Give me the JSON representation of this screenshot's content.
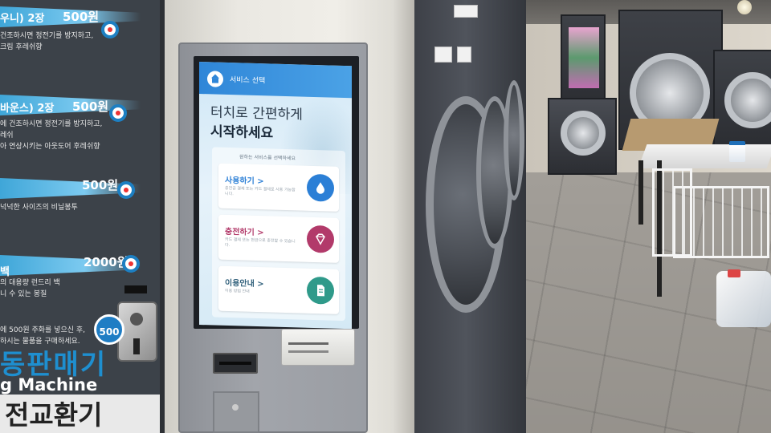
{
  "kiosk_screen": {
    "header_title": "서비스 선택",
    "headline_line1": "터치로 간편하게",
    "headline_line2": "시작하세요",
    "hint": "원하는 서비스를 선택하세요",
    "cards": [
      {
        "title": "사용하기 >",
        "sub": "충전금 결제 또는 카드 결제로 사용 가능합니다.",
        "icon": "water-drop-icon",
        "color": "#2b7fd6"
      },
      {
        "title": "충전하기 >",
        "sub": "카드 결제 또는 현금으로 충전할 수 있습니다.",
        "icon": "diamond-icon",
        "color": "#b23a6a"
      },
      {
        "title": "이용안내 >",
        "sub": "이용 방법 안내",
        "icon": "document-icon",
        "color": "#2f9a8a"
      }
    ]
  },
  "poster": {
    "items": [
      {
        "name": "우니) 2장",
        "price": "500원",
        "desc": "건조하시면 정전기를 방지하고,\n크림 후레쉬향"
      },
      {
        "name": "바운스) 2장",
        "price": "500원",
        "desc": "에 건조하시면 정전기를 방지하고,\n레쉬\n아 연상시키는 아웃도어 후레쉬향"
      },
      {
        "name": "",
        "price": "500원",
        "desc": "넉넉한 사이즈의 비닐봉투"
      },
      {
        "name": "백",
        "price": "2000원",
        "desc": "의 대용량 런드리 백\n니 수 있는 봉질"
      }
    ],
    "coin_note": "에 500원 주화를 넣으신 후,\n하시는 물품을 구매하세요.",
    "coin_badge": "500",
    "vending_title": "동판매기",
    "vending_sub": "g Machine",
    "exchanger": "전교환기"
  },
  "colors": {
    "kiosk_accent": "#2f86d8",
    "poster_blue": "#3fa6d8"
  }
}
